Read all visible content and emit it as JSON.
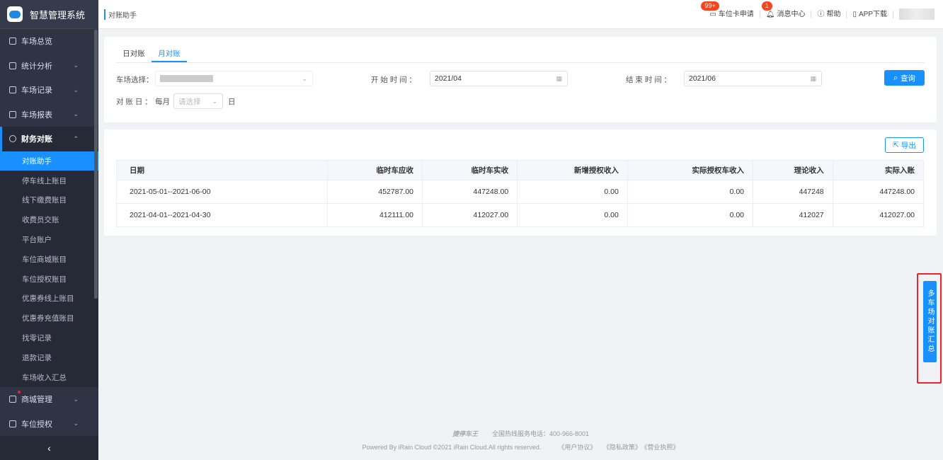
{
  "app": {
    "title": "智慧管理系统"
  },
  "sidebar": {
    "items": [
      {
        "label": "车场总览"
      },
      {
        "label": "统计分析"
      },
      {
        "label": "车场记录"
      },
      {
        "label": "车场报表"
      }
    ],
    "finance": {
      "label": "财务对账",
      "subs": [
        "对账助手",
        "停车线上账目",
        "线下缴费账目",
        "收费员交账",
        "平台账户",
        "车位商城账目",
        "车位授权账目",
        "优惠券线上账目",
        "优惠券充值账目",
        "找零记录",
        "退款记录",
        "车场收入汇总"
      ]
    },
    "after": [
      {
        "label": "商城管理"
      },
      {
        "label": "车位授权"
      }
    ],
    "collapse": "‹"
  },
  "header": {
    "breadcrumb": "对账助手",
    "items": [
      {
        "label": "车位卡申请",
        "badge": "99+"
      },
      {
        "label": "消息中心",
        "badge": "1"
      },
      {
        "label": "帮助"
      },
      {
        "label": "APP下载"
      }
    ]
  },
  "filters": {
    "tabs": [
      "日对账",
      "月对账"
    ],
    "lot_label": "车场选择：",
    "start_label": "开 始 时 间 ：",
    "start_value": "2021/04",
    "end_label": "结 束 时 间 ：",
    "end_value": "2021/06",
    "day_label": "对 账 日 ：",
    "monthly": "每月",
    "day_placeholder": "请选择",
    "day_suffix": "日",
    "query": "查询"
  },
  "table": {
    "export": "导出",
    "headers": [
      "日期",
      "临时车应收",
      "临时车实收",
      "新增授权收入",
      "实际授权车收入",
      "理论收入",
      "实际入账"
    ],
    "rows": [
      [
        "2021-05-01--2021-06-00",
        "452787.00",
        "447248.00",
        "0.00",
        "0.00",
        "447248",
        "447248.00"
      ],
      [
        "2021-04-01--2021-04-30",
        "412111.00",
        "412027.00",
        "0.00",
        "0.00",
        "412027",
        "412027.00"
      ]
    ]
  },
  "side_tab": "多车场对账汇总",
  "footer": {
    "brand": "捷停车王",
    "hotline": "全国热线服务电话：400-966-8001",
    "copyright": "Powered By iRain Cloud ©2021 iRain Cloud.All rights reserved.",
    "links": [
      "《用户协议》",
      "《隐私政策》",
      "《营业执照》"
    ]
  }
}
